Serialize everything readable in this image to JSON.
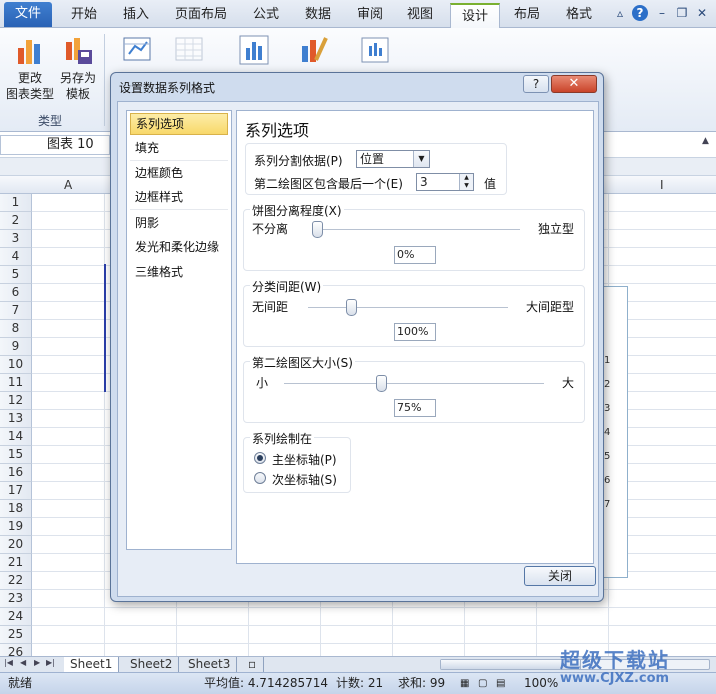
{
  "ribbon_tabs": [
    "文件",
    "开始",
    "插入",
    "页面布局",
    "公式",
    "数据",
    "审阅",
    "视图",
    "设计",
    "布局",
    "格式"
  ],
  "active_tab": "设计",
  "ribbon": {
    "change_type": "更改\n图表类型",
    "change_type_l1": "更改",
    "change_type_l2": "图表类型",
    "save_template_l1": "另存为",
    "save_template_l2": "模板",
    "group_type": "类型"
  },
  "namebox": "图表 10",
  "columns": [
    "A",
    "I"
  ],
  "rows": [
    "1",
    "2",
    "3",
    "4",
    "5",
    "6",
    "7",
    "8",
    "9",
    "10",
    "11",
    "12",
    "13",
    "14",
    "15",
    "16",
    "17",
    "18",
    "19",
    "20",
    "21",
    "22",
    "23",
    "24",
    "25",
    "26"
  ],
  "chart_axis_labels": [
    "1",
    "2",
    "3",
    "4",
    "5",
    "6",
    "7"
  ],
  "sheet_tabs": [
    "Sheet1",
    "Sheet2",
    "Sheet3"
  ],
  "status": {
    "ready": "就绪",
    "average": "平均值: 4.714285714",
    "count": "计数: 21",
    "sum": "求和: 99",
    "zoom": "100%"
  },
  "dialog": {
    "title": "设置数据系列格式",
    "help": "?",
    "close_x": "✕",
    "nav": [
      "系列选项",
      "填充",
      "边框颜色",
      "边框样式",
      "阴影",
      "发光和柔化边缘",
      "三维格式"
    ],
    "panel_title": "系列选项",
    "split_by_label": "系列分割依据(P)",
    "split_by_value": "位置",
    "second_plot_label": "第二绘图区包含最后一个(E)",
    "second_plot_value": "3",
    "second_plot_unit": "值",
    "explosion_label": "饼图分离程度(X)",
    "explosion_min": "不分离",
    "explosion_max": "独立型",
    "explosion_value": "0%",
    "explosion_level": 0,
    "gap_label": "分类间距(W)",
    "gap_min": "无间距",
    "gap_max": "大间距型",
    "gap_value": "100%",
    "gap_level": 0.2,
    "size_label": "第二绘图区大小(S)",
    "size_min": "小",
    "size_max": "大",
    "size_value": "75%",
    "size_level": 0.37,
    "plot_on_label": "系列绘制在",
    "primary_axis": "主坐标轴(P)",
    "secondary_axis": "次坐标轴(S)",
    "close_button": "关闭"
  },
  "watermark": {
    "title": "超级下载站",
    "url": "www.CJXZ.com"
  }
}
